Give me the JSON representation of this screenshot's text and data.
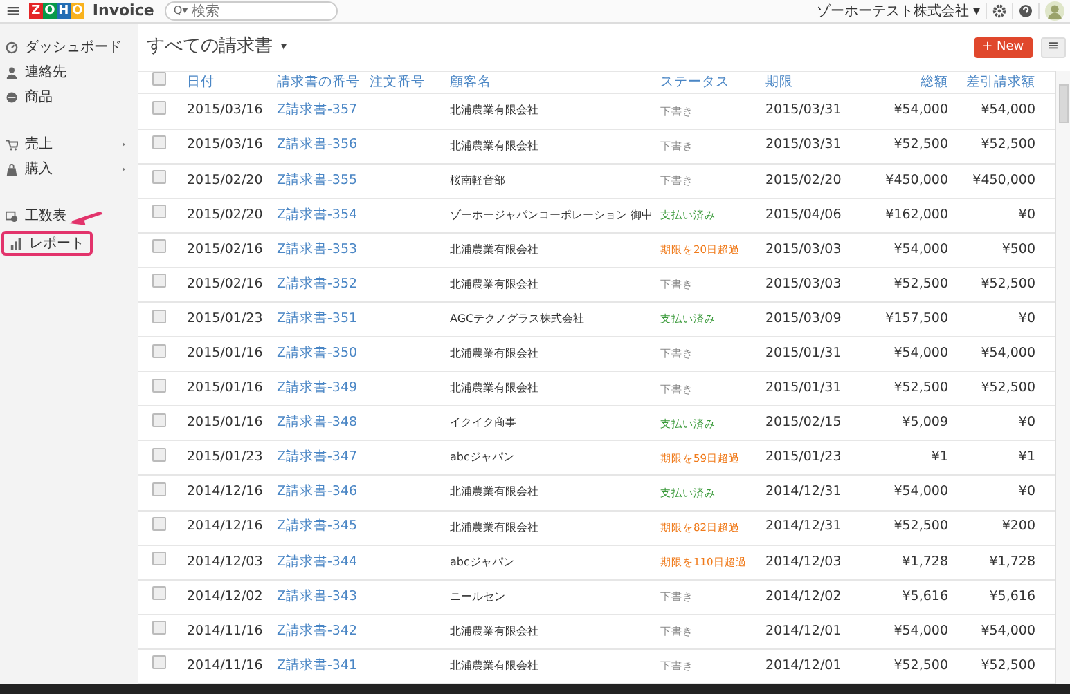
{
  "topbar": {
    "menu_glyph": "≡",
    "logo_letters": [
      "Z",
      "O",
      "H",
      "O"
    ],
    "app_name": "Invoice",
    "search": {
      "glyph": "Q▾",
      "placeholder": "検索"
    },
    "organization": "ゾーホーテスト株式会社",
    "caret": "▾"
  },
  "sidebar": {
    "groups": [
      [
        {
          "label": "ダッシュボード",
          "submenu": false,
          "annotated": false
        },
        {
          "label": "連絡先",
          "submenu": false,
          "annotated": false
        },
        {
          "label": "商品",
          "submenu": false,
          "annotated": false
        }
      ],
      [
        {
          "label": "売上",
          "submenu": true,
          "annotated": false
        },
        {
          "label": "購入",
          "submenu": true,
          "annotated": false
        }
      ],
      [
        {
          "label": "工数表",
          "submenu": false,
          "annotated": false
        },
        {
          "label": "レポート",
          "submenu": false,
          "annotated": true
        }
      ]
    ]
  },
  "page": {
    "title": "すべての請求書",
    "caret": "▾",
    "new_button": {
      "glyph": "+",
      "label": "New"
    },
    "menu_glyph": "≡"
  },
  "table": {
    "select_all_checked": false,
    "columns": [
      "日付",
      "請求書の番号",
      "注文番号",
      "顧客名",
      "ステータス",
      "期限",
      "総額",
      "差引請求額"
    ],
    "rows": [
      {
        "checked": false,
        "date": "2015/03/16",
        "number": "Z請求書-357",
        "customer": "北浦農業有限会社",
        "status": {
          "kind": "draft",
          "text": "下書き"
        },
        "due": "2015/03/31",
        "total": "¥54,000",
        "balance": "¥54,000"
      },
      {
        "checked": false,
        "date": "2015/03/16",
        "number": "Z請求書-356",
        "customer": "北浦農業有限会社",
        "status": {
          "kind": "draft",
          "text": "下書き"
        },
        "due": "2015/03/31",
        "total": "¥52,500",
        "balance": "¥52,500"
      },
      {
        "checked": false,
        "date": "2015/02/20",
        "number": "Z請求書-355",
        "customer": "桜南軽音部",
        "status": {
          "kind": "draft",
          "text": "下書き"
        },
        "due": "2015/02/20",
        "total": "¥450,000",
        "balance": "¥450,000"
      },
      {
        "checked": false,
        "date": "2015/02/20",
        "number": "Z請求書-354",
        "customer": "ゾーホージャパンコーポレーション 御中",
        "status": {
          "kind": "paid",
          "text": "支払い済み"
        },
        "due": "2015/04/06",
        "total": "¥162,000",
        "balance": "¥0"
      },
      {
        "checked": false,
        "date": "2015/02/16",
        "number": "Z請求書-353",
        "customer": "北浦農業有限会社",
        "status": {
          "kind": "overdue",
          "text": "期限を20日超過"
        },
        "due": "2015/03/03",
        "total": "¥54,000",
        "balance": "¥500"
      },
      {
        "checked": false,
        "date": "2015/02/16",
        "number": "Z請求書-352",
        "customer": "北浦農業有限会社",
        "status": {
          "kind": "draft",
          "text": "下書き"
        },
        "due": "2015/03/03",
        "total": "¥52,500",
        "balance": "¥52,500"
      },
      {
        "checked": false,
        "date": "2015/01/23",
        "number": "Z請求書-351",
        "customer": "AGCテクノグラス株式会社",
        "status": {
          "kind": "paid",
          "text": "支払い済み"
        },
        "due": "2015/03/09",
        "total": "¥157,500",
        "balance": "¥0"
      },
      {
        "checked": false,
        "date": "2015/01/16",
        "number": "Z請求書-350",
        "customer": "北浦農業有限会社",
        "status": {
          "kind": "draft",
          "text": "下書き"
        },
        "due": "2015/01/31",
        "total": "¥54,000",
        "balance": "¥54,000"
      },
      {
        "checked": false,
        "date": "2015/01/16",
        "number": "Z請求書-349",
        "customer": "北浦農業有限会社",
        "status": {
          "kind": "draft",
          "text": "下書き"
        },
        "due": "2015/01/31",
        "total": "¥52,500",
        "balance": "¥52,500"
      },
      {
        "checked": false,
        "date": "2015/01/16",
        "number": "Z請求書-348",
        "customer": "イクイク商事",
        "status": {
          "kind": "paid",
          "text": "支払い済み"
        },
        "due": "2015/02/15",
        "total": "¥5,009",
        "balance": "¥0"
      },
      {
        "checked": false,
        "date": "2015/01/23",
        "number": "Z請求書-347",
        "customer": "abcジャパン",
        "status": {
          "kind": "overdue",
          "text": "期限を59日超過"
        },
        "due": "2015/01/23",
        "total": "¥1",
        "balance": "¥1"
      },
      {
        "checked": false,
        "date": "2014/12/16",
        "number": "Z請求書-346",
        "customer": "北浦農業有限会社",
        "status": {
          "kind": "paid",
          "text": "支払い済み"
        },
        "due": "2014/12/31",
        "total": "¥54,000",
        "balance": "¥0"
      },
      {
        "checked": false,
        "date": "2014/12/16",
        "number": "Z請求書-345",
        "customer": "北浦農業有限会社",
        "status": {
          "kind": "overdue",
          "text": "期限を82日超過"
        },
        "due": "2014/12/31",
        "total": "¥52,500",
        "balance": "¥200"
      },
      {
        "checked": false,
        "date": "2014/12/03",
        "number": "Z請求書-344",
        "customer": "abcジャパン",
        "status": {
          "kind": "overdue",
          "text": "期限を110日超過"
        },
        "due": "2014/12/03",
        "total": "¥1,728",
        "balance": "¥1,728"
      },
      {
        "checked": false,
        "date": "2014/12/02",
        "number": "Z請求書-343",
        "customer": "ニールセン",
        "status": {
          "kind": "draft",
          "text": "下書き"
        },
        "due": "2014/12/02",
        "total": "¥5,616",
        "balance": "¥5,616"
      },
      {
        "checked": false,
        "date": "2014/11/16",
        "number": "Z請求書-342",
        "customer": "北浦農業有限会社",
        "status": {
          "kind": "draft",
          "text": "下書き"
        },
        "due": "2014/12/01",
        "total": "¥54,000",
        "balance": "¥54,000"
      },
      {
        "checked": false,
        "date": "2014/11/16",
        "number": "Z請求書-341",
        "customer": "北浦農業有限会社",
        "status": {
          "kind": "draft",
          "text": "下書き"
        },
        "due": "2014/12/01",
        "total": "¥52,500",
        "balance": "¥52,500"
      }
    ]
  }
}
